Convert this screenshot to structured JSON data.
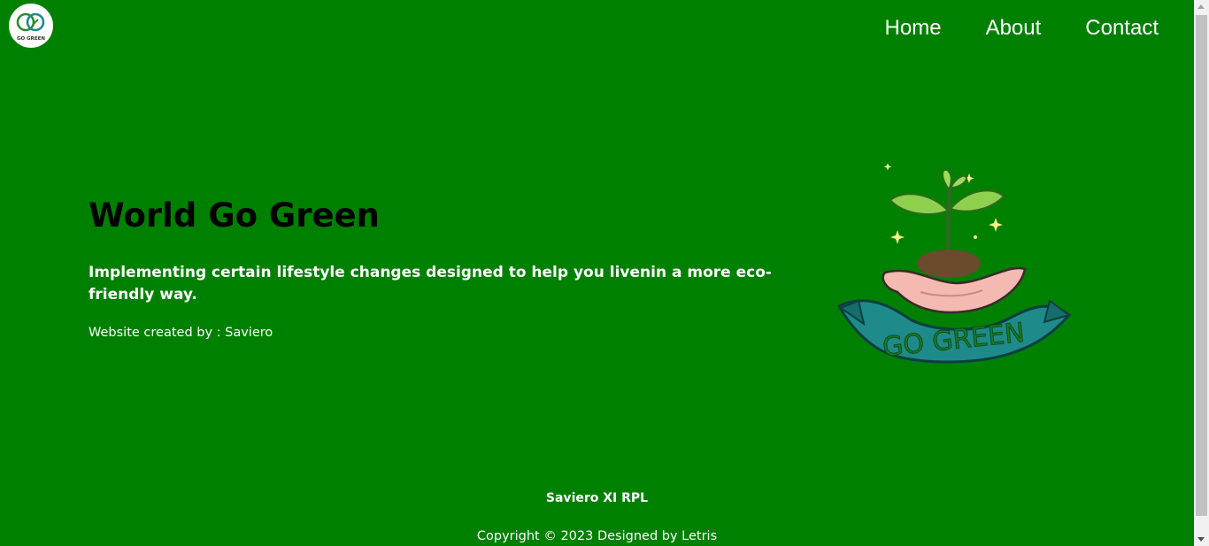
{
  "header": {
    "logo_text": "GO GREEN",
    "nav": [
      {
        "label": "Home"
      },
      {
        "label": "About"
      },
      {
        "label": "Contact"
      }
    ]
  },
  "hero": {
    "title": "World Go Green",
    "subtitle": "Implementing certain lifestyle changes designed to help you livenin a more eco-friendly way.",
    "credit": "Website created by : Saviero",
    "illustration": {
      "icon": "sprout-in-hand-icon",
      "banner_text": "GO GREEN"
    }
  },
  "footer": {
    "name": "Saviero XI RPL",
    "copyright": "Copyright © 2023 Designed by Letris"
  },
  "colors": {
    "background": "#008000",
    "heading": "#000000",
    "text": "#ffffff",
    "banner": "#1f8a8a",
    "leaf": "#8fd14f",
    "hand": "#f4b9b1"
  }
}
